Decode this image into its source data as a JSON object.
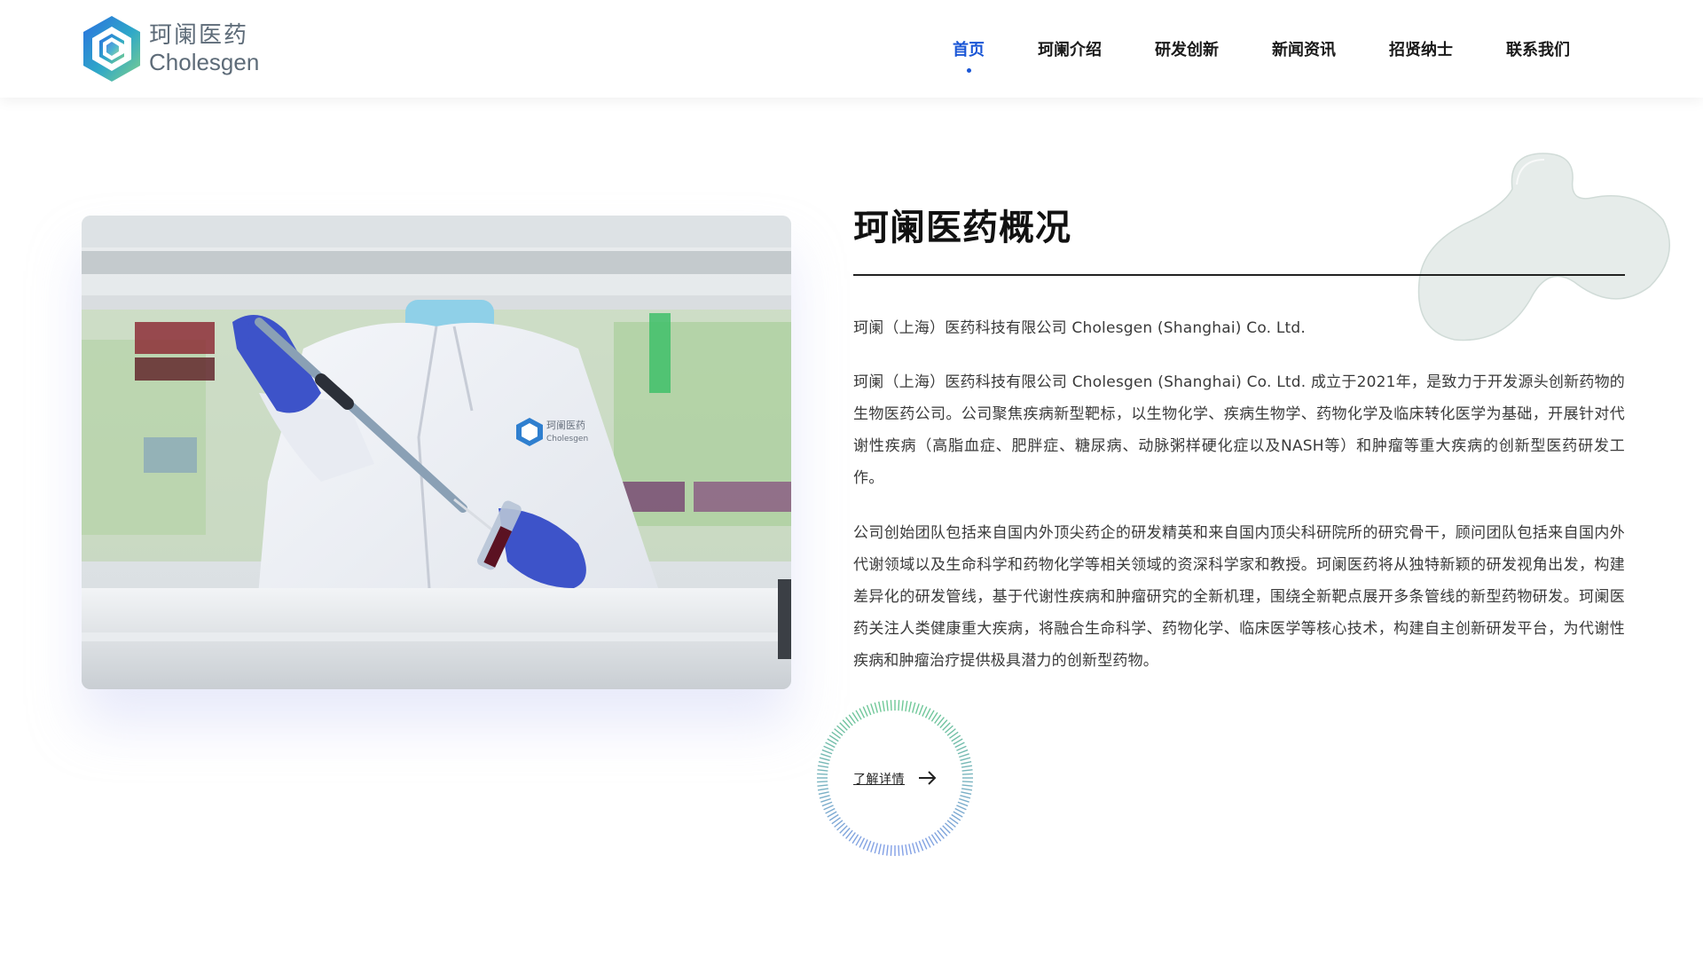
{
  "brand": {
    "name_cn": "珂阑医药",
    "name_en": "Cholesgen",
    "colors": {
      "blue": "#1a56d6",
      "teal": "#3fb8a8",
      "green": "#7cc98a"
    }
  },
  "nav": {
    "items": [
      {
        "label": "首页",
        "active": true
      },
      {
        "label": "珂阑介绍",
        "active": false
      },
      {
        "label": "研发创新",
        "active": false
      },
      {
        "label": "新闻资讯",
        "active": false
      },
      {
        "label": "招贤纳士",
        "active": false
      },
      {
        "label": "联系我们",
        "active": false
      }
    ]
  },
  "about": {
    "title": "珂阑医药概况",
    "company_line": "珂阑（上海）医药科技有限公司 Cholesgen (Shanghai) Co. Ltd.",
    "paragraph_1": "珂阑（上海）医药科技有限公司 Cholesgen (Shanghai) Co. Ltd. 成立于2021年，是致力于开发源头创新药物的生物医药公司。公司聚焦疾病新型靶标，以生物化学、疾病生物学、药物化学及临床转化医学为基础，开展针对代谢性疾病（高脂血症、肥胖症、糖尿病、动脉粥样硬化症以及NASH等）和肿瘤等重大疾病的创新型医药研发工作。",
    "paragraph_2": "公司创始团队包括来自国内外顶尖药企的研发精英和来自国内顶尖科研院所的研究骨干，顾问团队包括来自国内外代谢领域以及生命科学和药物化学等相关领域的资深科学家和教授。珂阑医药将从独特新颖的研发视角出发，构建差异化的研发管线，基于代谢性疾病和肿瘤研究的全新机理，围绕全新靶点展开多条管线的新型药物研发。珂阑医药关注人类健康重大疾病，将融合生命科学、药物化学、临床医学等核心技术，构建自主创新研发平台，为代谢性疾病和肿瘤治疗提供极具潜力的创新型药物。",
    "more_label": "了解详情",
    "photo_coat_logo_cn": "珂阑医药",
    "photo_coat_logo_en": "Cholesgen"
  },
  "icons": {
    "logo": "cholesgen-logo-icon",
    "arrow": "arrow-right-icon"
  }
}
